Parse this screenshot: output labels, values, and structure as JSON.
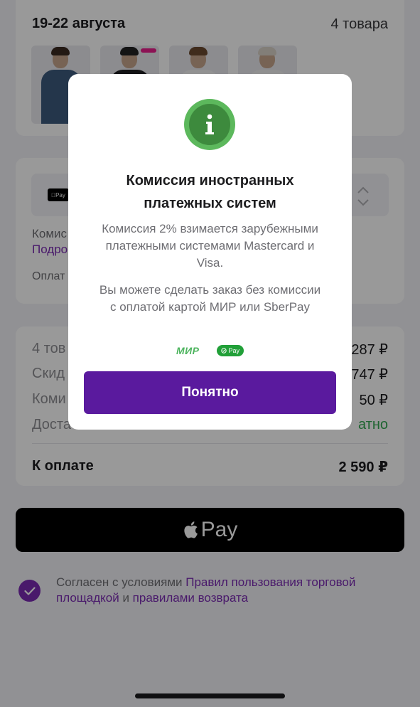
{
  "delivery": {
    "date": "19-22 августа",
    "count": "4 товара",
    "products": [
      {
        "shirt_color": "#3c5a7e",
        "hair_color": "#3b2a20"
      },
      {
        "shirt_color": "#1f1f22",
        "hair_color": "#222222",
        "sale_badge": true
      },
      {
        "shirt_color": "#f4f4f4",
        "hair_color": "#6b4a30"
      },
      {
        "shirt_color": "#f1f1f1",
        "hair_color": "#d9d3c8"
      }
    ]
  },
  "payment": {
    "mini_logo": "Pay",
    "line1": "Комис",
    "line2": "Подро",
    "line3": "Оплат"
  },
  "summary": {
    "rows": [
      {
        "label": "4 тов",
        "value": "287 ₽"
      },
      {
        "label": "Скид",
        "value": "747 ₽"
      },
      {
        "label": "Коми",
        "value": "50 ₽"
      },
      {
        "label": "Доста",
        "value": "атно"
      }
    ],
    "total_label": "К оплате",
    "total_value": "2 590 ₽"
  },
  "applepay_button": {
    "label": "Pay"
  },
  "consent": {
    "prefix": "Согласен с условиями ",
    "link1": "Правил пользования торговой площадкой",
    "middle": " и ",
    "link2": "правилами возврата"
  },
  "modal": {
    "title": "Комиссия иностранных платежных систем",
    "text1": "Комиссия 2% взимается зарубежными платежными системами Mastercard и Visa.",
    "text2": "Вы можете сделать заказ без комиссии с оплатой картой МИР или SberPay",
    "mir_logo": "МИР",
    "sberpay_logo": "Pay",
    "button": "Понятно"
  },
  "colors": {
    "accent_purple": "#5a1a9e",
    "link_purple": "#7b2bb3",
    "success_green": "#34a853",
    "info_green": "#5cb85c"
  }
}
